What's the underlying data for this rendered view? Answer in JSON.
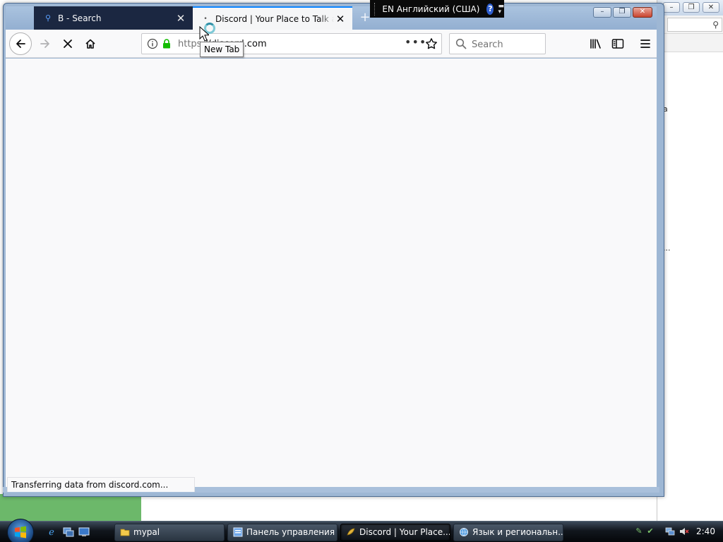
{
  "browser": {
    "tabs": [
      {
        "title": "B - Search",
        "favicon": "search-icon",
        "active": false
      },
      {
        "title": "Discord | Your Place to Talk and",
        "favicon": "loading-icon",
        "active": true
      }
    ],
    "tooltip": "New Tab",
    "url": {
      "protocol": "https",
      "rest": "://discord.com"
    },
    "search_placeholder": "Search",
    "status_text": "Transferring data from discord.com...",
    "accent_color": "#0a84ff",
    "toolbar_icons": [
      "back-icon",
      "forward-icon",
      "stop-icon",
      "home-icon",
      "info-icon",
      "lock-icon",
      "page-actions-icon",
      "bookmark-star-icon",
      "library-icon",
      "sidebar-icon",
      "hamburger-menu-icon"
    ]
  },
  "language_bar": {
    "label": "EN Английский (США)",
    "help": "?"
  },
  "background_window": {
    "fragment_1": "a",
    "fragment_2": "..."
  },
  "taskbar": {
    "buttons": [
      {
        "label": "mypal",
        "icon": "folder-icon"
      },
      {
        "label": "Панель управления",
        "icon": "control-panel-icon"
      },
      {
        "label": "Discord | Your Place...",
        "icon": "mypal-browser-icon",
        "active": true
      },
      {
        "label": "Язык и региональн...",
        "icon": "globe-icon"
      }
    ],
    "clock": "2:40"
  }
}
